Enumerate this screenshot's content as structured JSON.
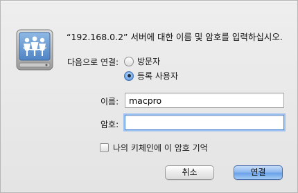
{
  "dialog": {
    "prompt": "“192.168.0.2” 서버에 대한 이름 및 암호를 입력하십시오.",
    "icon": "network-server-icon"
  },
  "connect_as": {
    "label": "다음으로 연결:",
    "options": [
      {
        "label": "방문자",
        "selected": false
      },
      {
        "label": "등록 사용자",
        "selected": true
      }
    ]
  },
  "fields": {
    "name_label": "이름:",
    "name_value": "macpro",
    "password_label": "암호:",
    "password_value": ""
  },
  "keychain": {
    "label": "나의 키체인에 이 암호 기억",
    "checked": false
  },
  "buttons": {
    "cancel": "취소",
    "connect": "연결"
  },
  "colors": {
    "accent": "#6aa1e8",
    "focus_ring": "#9cc1f0"
  }
}
